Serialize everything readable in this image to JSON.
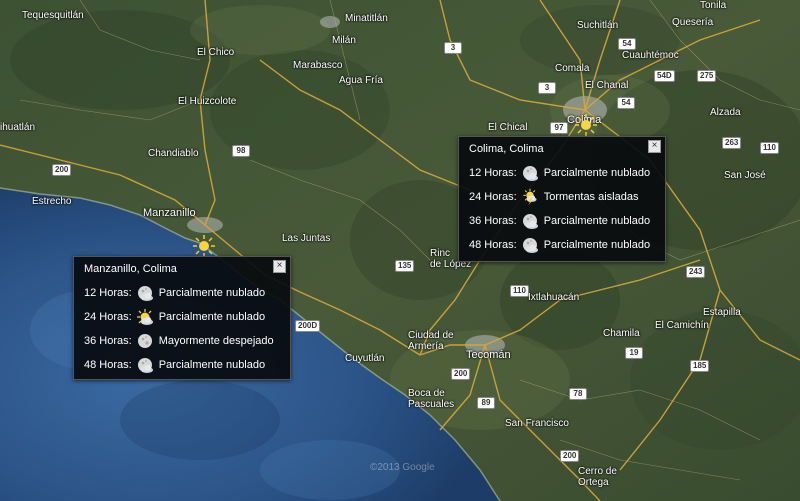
{
  "map": {
    "places": [
      {
        "id": "tequesquitlan",
        "name": "Tequesquitlán"
      },
      {
        "id": "minatitlan",
        "name": "Minatitlán"
      },
      {
        "id": "milan",
        "name": "Milán"
      },
      {
        "id": "suchitlan",
        "name": "Suchitlán"
      },
      {
        "id": "queseria",
        "name": "Quesería"
      },
      {
        "id": "tonila",
        "name": "Tonila"
      },
      {
        "id": "cuauhtemoc",
        "name": "Cuauhtémoc"
      },
      {
        "id": "el-chico",
        "name": "El Chico"
      },
      {
        "id": "marabasco",
        "name": "Marabasco"
      },
      {
        "id": "agua-fria",
        "name": "Agua Fría"
      },
      {
        "id": "comala",
        "name": "Comala"
      },
      {
        "id": "el-chanal",
        "name": "El Chanal"
      },
      {
        "id": "el-huizcolote",
        "name": "El Huizcolote"
      },
      {
        "id": "alzada",
        "name": "Alzada"
      },
      {
        "id": "cihuatlan",
        "name": "ihuatlán"
      },
      {
        "id": "el-chical",
        "name": "El Chical"
      },
      {
        "id": "colima",
        "name": "Colima"
      },
      {
        "id": "chandiablo",
        "name": "Chandiablo"
      },
      {
        "id": "san-jose",
        "name": "San José"
      },
      {
        "id": "estrecho",
        "name": "Estrecho"
      },
      {
        "id": "manzanillo",
        "name": "Manzanillo"
      },
      {
        "id": "las-juntas",
        "name": "Las Juntas"
      },
      {
        "id": "rincon-de-lopez",
        "name": "Rinc\nde López"
      },
      {
        "id": "ixtlahuacan",
        "name": "Ixtlahuacán"
      },
      {
        "id": "estapilla",
        "name": "Estapilla"
      },
      {
        "id": "chamila",
        "name": "Chamila"
      },
      {
        "id": "el-camichin",
        "name": "El Camichín"
      },
      {
        "id": "ciudad-de-armeria",
        "name": "Ciudad de\nArmería"
      },
      {
        "id": "cuyutlan",
        "name": "Cuyutlán"
      },
      {
        "id": "tecoman",
        "name": "Tecomán"
      },
      {
        "id": "boca-de-pascuales",
        "name": "Boca de\nPascuales"
      },
      {
        "id": "san-francisco",
        "name": "San Francisco"
      },
      {
        "id": "cerro-de-ortega",
        "name": "Cerro de\nOrtega"
      }
    ],
    "highways": [
      {
        "id": "h3",
        "label": "3"
      },
      {
        "id": "h54",
        "label": "54"
      },
      {
        "id": "h54d",
        "label": "54D"
      },
      {
        "id": "h275",
        "label": "275"
      },
      {
        "id": "h3b",
        "label": "3"
      },
      {
        "id": "h54b",
        "label": "54"
      },
      {
        "id": "h263",
        "label": "263"
      },
      {
        "id": "h110",
        "label": "110"
      },
      {
        "id": "h200",
        "label": "200"
      },
      {
        "id": "h98",
        "label": "98"
      },
      {
        "id": "h97",
        "label": "97"
      },
      {
        "id": "h135",
        "label": "135"
      },
      {
        "id": "h110b",
        "label": "110"
      },
      {
        "id": "h243",
        "label": "243"
      },
      {
        "id": "h200d",
        "label": "200D"
      },
      {
        "id": "h19",
        "label": "19"
      },
      {
        "id": "h185",
        "label": "185"
      },
      {
        "id": "h200b",
        "label": "200"
      },
      {
        "id": "h89",
        "label": "89"
      },
      {
        "id": "h78",
        "label": "78"
      },
      {
        "id": "h200c",
        "label": "200"
      }
    ],
    "attribution": "©2013 Google",
    "colors": {
      "ocean": "#2f5a8f",
      "land": "#3e4f33",
      "road": "#d6a93a",
      "city": "#b9b9b9"
    }
  },
  "popups": {
    "colima": {
      "title": "Colima, Colima",
      "close_label": "×",
      "rows": [
        {
          "label": "12 Horas:",
          "icon": "cloudy-moon-icon",
          "desc": "Parcialmente nublado"
        },
        {
          "label": "24 Horas:",
          "icon": "storm-sun-icon",
          "desc": "Tormentas aisladas"
        },
        {
          "label": "36 Horas:",
          "icon": "cloudy-moon-icon",
          "desc": "Parcialmente nublado"
        },
        {
          "label": "48 Horas:",
          "icon": "cloudy-moon-icon",
          "desc": "Parcialmente nublado"
        }
      ]
    },
    "manzanillo": {
      "title": "Manzanillo, Colima",
      "close_label": "×",
      "rows": [
        {
          "label": "12 Horas:",
          "icon": "cloudy-moon-icon",
          "desc": "Parcialmente nublado"
        },
        {
          "label": "24 Horas:",
          "icon": "cloudy-sun-icon",
          "desc": "Parcialmente nublado"
        },
        {
          "label": "36 Horas:",
          "icon": "moon-icon",
          "desc": "Mayormente despejado"
        },
        {
          "label": "48 Horas:",
          "icon": "cloudy-moon-icon",
          "desc": "Parcialmente nublado"
        }
      ]
    }
  }
}
